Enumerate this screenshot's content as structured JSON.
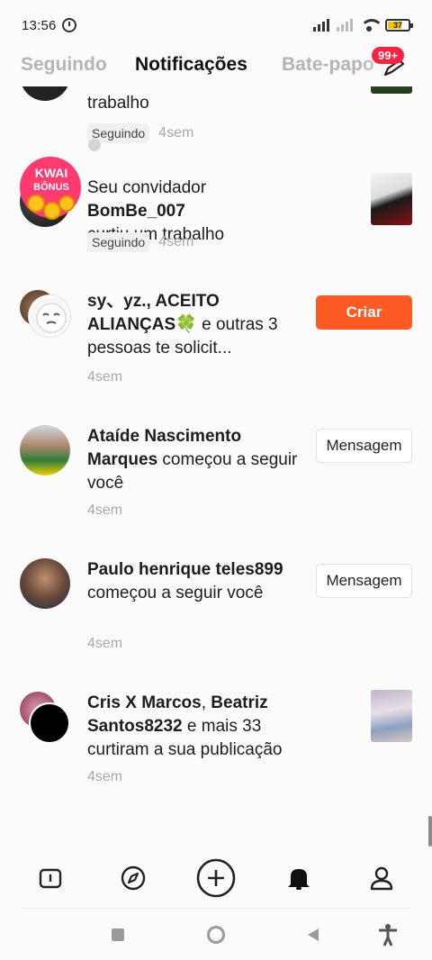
{
  "status_bar": {
    "time": "13:56",
    "battery": "37"
  },
  "tabs": [
    {
      "label": "Seguindo",
      "active": false
    },
    {
      "label": "Notificações",
      "active": true
    },
    {
      "label": "Bate-papo",
      "active": false
    }
  ],
  "chat_badge": "99+",
  "notifications": [
    {
      "text_tail": "trabalho",
      "chip": "Seguindo",
      "time": "4sem"
    },
    {
      "prefix": "Seu convidador ",
      "name": "BomBe_007",
      "suffix": "curtiu um trabalho",
      "chip": "Seguindo",
      "time": "4sem",
      "promo_line1": "KWAI",
      "promo_line2": "BÔNUS"
    },
    {
      "name": "sy、yz., ACEITO ALIANÇAS🍀",
      "suffix": " e outras 3 pessoas te solicit...",
      "time": "4sem",
      "button": "Criar"
    },
    {
      "name": "Ataíde Nascimento Marques",
      "suffix": " começou a seguir você",
      "time": "4sem",
      "button": "Mensagem"
    },
    {
      "name": "Paulo henrique teles899",
      "suffix": " começou a seguir você",
      "time": "4sem",
      "button": "Mensagem"
    },
    {
      "name": "Cris X Marcos",
      "sep": ", ",
      "name2": "Beatriz Santos8232",
      "suffix": " e mais 33 curtiram a sua publicação",
      "time": "4sem"
    }
  ],
  "bottom_nav": [
    {
      "icon": "home-icon"
    },
    {
      "icon": "discover-icon"
    },
    {
      "icon": "create-icon"
    },
    {
      "icon": "bell-icon"
    },
    {
      "icon": "profile-icon"
    }
  ],
  "colors": {
    "accent": "#fe5b24",
    "badge": "#ff1f3e",
    "muted": "#a8a8ab"
  }
}
